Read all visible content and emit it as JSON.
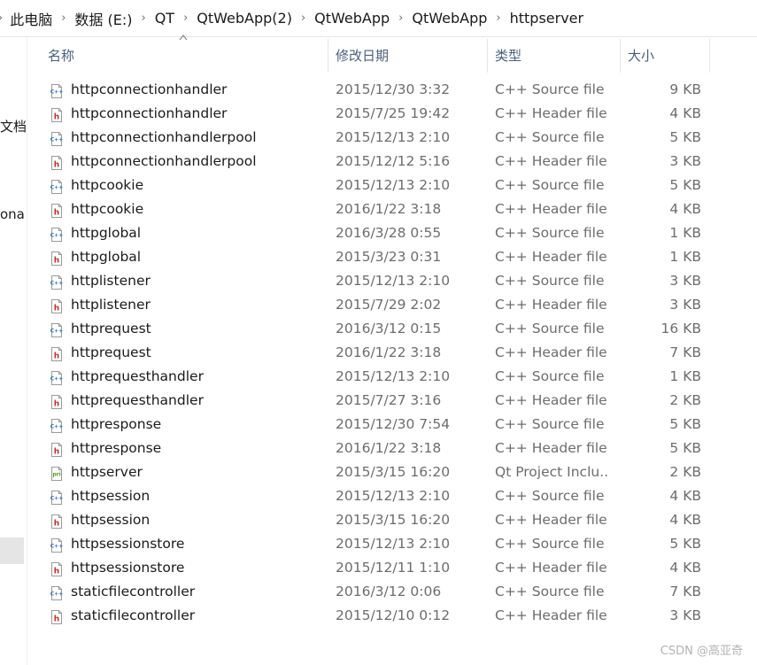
{
  "breadcrumb": [
    "此电脑",
    "数据 (E:)",
    "QT",
    "QtWebApp(2)",
    "QtWebApp",
    "QtWebApp",
    "httpserver"
  ],
  "nav_pane": {
    "label_1": "文档",
    "label_2": "ona"
  },
  "columns": {
    "name": "名称",
    "date": "修改日期",
    "type": "类型",
    "size": "大小"
  },
  "files": [
    {
      "icon": "cpp-source-icon",
      "name": "httpconnectionhandler",
      "date": "2015/12/30 3:32",
      "type": "C++ Source file",
      "size": "9 KB"
    },
    {
      "icon": "cpp-header-icon",
      "name": "httpconnectionhandler",
      "date": "2015/7/25 19:42",
      "type": "C++ Header file",
      "size": "4 KB"
    },
    {
      "icon": "cpp-source-icon",
      "name": "httpconnectionhandlerpool",
      "date": "2015/12/13 2:10",
      "type": "C++ Source file",
      "size": "5 KB"
    },
    {
      "icon": "cpp-header-icon",
      "name": "httpconnectionhandlerpool",
      "date": "2015/12/12 5:16",
      "type": "C++ Header file",
      "size": "3 KB"
    },
    {
      "icon": "cpp-source-icon",
      "name": "httpcookie",
      "date": "2015/12/13 2:10",
      "type": "C++ Source file",
      "size": "5 KB"
    },
    {
      "icon": "cpp-header-icon",
      "name": "httpcookie",
      "date": "2016/1/22 3:18",
      "type": "C++ Header file",
      "size": "4 KB"
    },
    {
      "icon": "cpp-source-icon",
      "name": "httpglobal",
      "date": "2016/3/28 0:55",
      "type": "C++ Source file",
      "size": "1 KB"
    },
    {
      "icon": "cpp-header-icon",
      "name": "httpglobal",
      "date": "2015/3/23 0:31",
      "type": "C++ Header file",
      "size": "1 KB"
    },
    {
      "icon": "cpp-source-icon",
      "name": "httplistener",
      "date": "2015/12/13 2:10",
      "type": "C++ Source file",
      "size": "3 KB"
    },
    {
      "icon": "cpp-header-icon",
      "name": "httplistener",
      "date": "2015/7/29 2:02",
      "type": "C++ Header file",
      "size": "3 KB"
    },
    {
      "icon": "cpp-source-icon",
      "name": "httprequest",
      "date": "2016/3/12 0:15",
      "type": "C++ Source file",
      "size": "16 KB"
    },
    {
      "icon": "cpp-header-icon",
      "name": "httprequest",
      "date": "2016/1/22 3:18",
      "type": "C++ Header file",
      "size": "7 KB"
    },
    {
      "icon": "cpp-source-icon",
      "name": "httprequesthandler",
      "date": "2015/12/13 2:10",
      "type": "C++ Source file",
      "size": "1 KB"
    },
    {
      "icon": "cpp-header-icon",
      "name": "httprequesthandler",
      "date": "2015/7/27 3:16",
      "type": "C++ Header file",
      "size": "2 KB"
    },
    {
      "icon": "cpp-source-icon",
      "name": "httpresponse",
      "date": "2015/12/30 7:54",
      "type": "C++ Source file",
      "size": "5 KB"
    },
    {
      "icon": "cpp-header-icon",
      "name": "httpresponse",
      "date": "2016/1/22 3:18",
      "type": "C++ Header file",
      "size": "5 KB"
    },
    {
      "icon": "qt-project-include-icon",
      "name": "httpserver",
      "date": "2015/3/15 16:20",
      "type": "Qt Project Inclu...",
      "size": "2 KB"
    },
    {
      "icon": "cpp-source-icon",
      "name": "httpsession",
      "date": "2015/12/13 2:10",
      "type": "C++ Source file",
      "size": "4 KB"
    },
    {
      "icon": "cpp-header-icon",
      "name": "httpsession",
      "date": "2015/3/15 16:20",
      "type": "C++ Header file",
      "size": "4 KB"
    },
    {
      "icon": "cpp-source-icon",
      "name": "httpsessionstore",
      "date": "2015/12/13 2:10",
      "type": "C++ Source file",
      "size": "5 KB"
    },
    {
      "icon": "cpp-header-icon",
      "name": "httpsessionstore",
      "date": "2015/12/11 1:10",
      "type": "C++ Header file",
      "size": "4 KB"
    },
    {
      "icon": "cpp-source-icon",
      "name": "staticfilecontroller",
      "date": "2016/3/12 0:06",
      "type": "C++ Source file",
      "size": "7 KB"
    },
    {
      "icon": "cpp-header-icon",
      "name": "staticfilecontroller",
      "date": "2015/12/10 0:12",
      "type": "C++ Header file",
      "size": "3 KB"
    }
  ],
  "watermark": "CSDN @高亚奇",
  "colors": {
    "header_text": "#4c607a",
    "cpp_icon": "#2f6fbf",
    "h_icon": "#c0302c",
    "pri_icon": "#4c9a2a"
  }
}
